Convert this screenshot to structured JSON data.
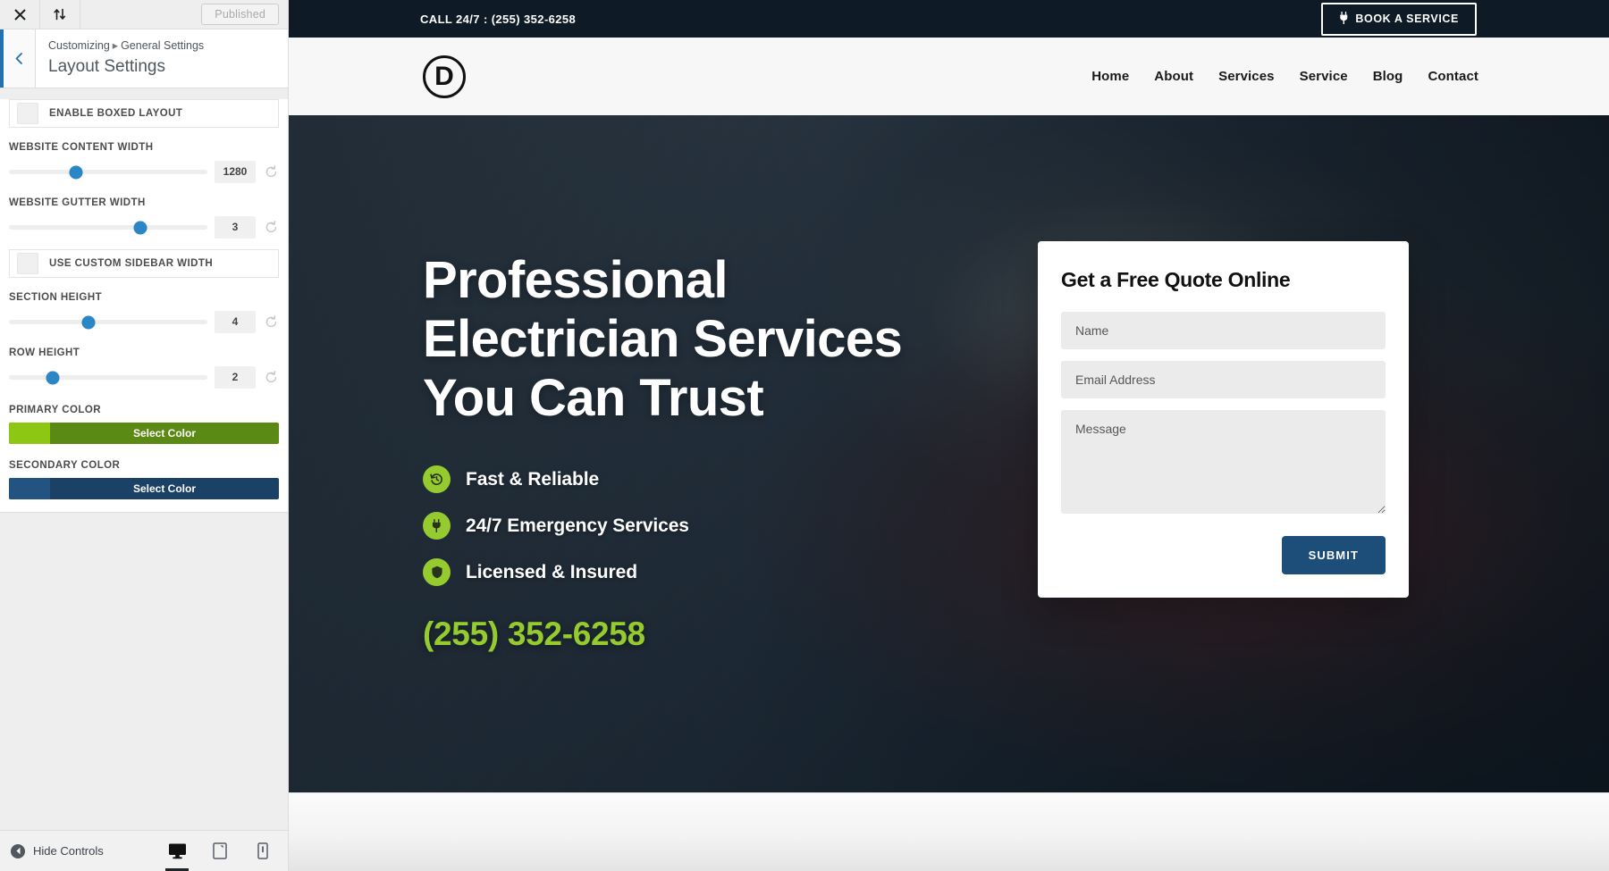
{
  "customizer": {
    "topbar": {
      "close_icon": "close-icon",
      "collapse_icon": "expand-collapse-icon",
      "published_label": "Published"
    },
    "header": {
      "back_icon": "chevron-left-icon",
      "breadcrumb_root": "Customizing",
      "breadcrumb_separator": "▸",
      "breadcrumb_parent": "General Settings",
      "page_title": "Layout Settings"
    },
    "controls": [
      {
        "type": "toggle",
        "label": "Enable Boxed Layout",
        "checked": false
      },
      {
        "type": "range",
        "label": "Website Content Width",
        "value": "1280",
        "thumb_percent": 34
      },
      {
        "type": "range",
        "label": "Website Gutter Width",
        "value": "3",
        "thumb_percent": 66
      },
      {
        "type": "toggle",
        "label": "Use Custom Sidebar Width",
        "checked": false
      },
      {
        "type": "range",
        "label": "Section Height",
        "value": "4",
        "thumb_percent": 40
      },
      {
        "type": "range",
        "label": "Row Height",
        "value": "2",
        "thumb_percent": 22
      },
      {
        "type": "color",
        "label": "Primary Color",
        "button_label": "Select Color",
        "swatch": "#8dc713",
        "body": "#5b8a14"
      },
      {
        "type": "color",
        "label": "Secondary Color",
        "button_label": "Select Color",
        "swatch": "#235380",
        "body": "#1b4167"
      }
    ],
    "footer": {
      "hide_controls_label": "Hide Controls",
      "devices": [
        {
          "name": "desktop",
          "active": true
        },
        {
          "name": "tablet",
          "active": false
        },
        {
          "name": "mobile",
          "active": false
        }
      ]
    }
  },
  "site": {
    "topbar": {
      "phone_text": "CALL 24/7 : (255) 352-6258",
      "book_button": "BOOK A SERVICE",
      "book_button_icon": "plug-icon"
    },
    "nav": {
      "logo_letter": "D",
      "items": [
        "Home",
        "About",
        "Services",
        "Service",
        "Blog",
        "Contact"
      ]
    },
    "hero": {
      "title_lines": [
        "Professional",
        "Electrician Services",
        "You Can Trust"
      ],
      "features": [
        {
          "icon": "clock-rewind-icon",
          "label": "Fast & Reliable"
        },
        {
          "icon": "plug-icon",
          "label": "24/7 Emergency Services"
        },
        {
          "icon": "shield-icon",
          "label": "Licensed & Insured"
        }
      ],
      "phone": "(255) 352-6258",
      "accent_color": "#96cb2f"
    },
    "quote_form": {
      "title": "Get a Free Quote Online",
      "name_placeholder": "Name",
      "email_placeholder": "Email Address",
      "message_placeholder": "Message",
      "submit_label": "SUBMIT",
      "submit_color": "#1d4e79"
    }
  }
}
